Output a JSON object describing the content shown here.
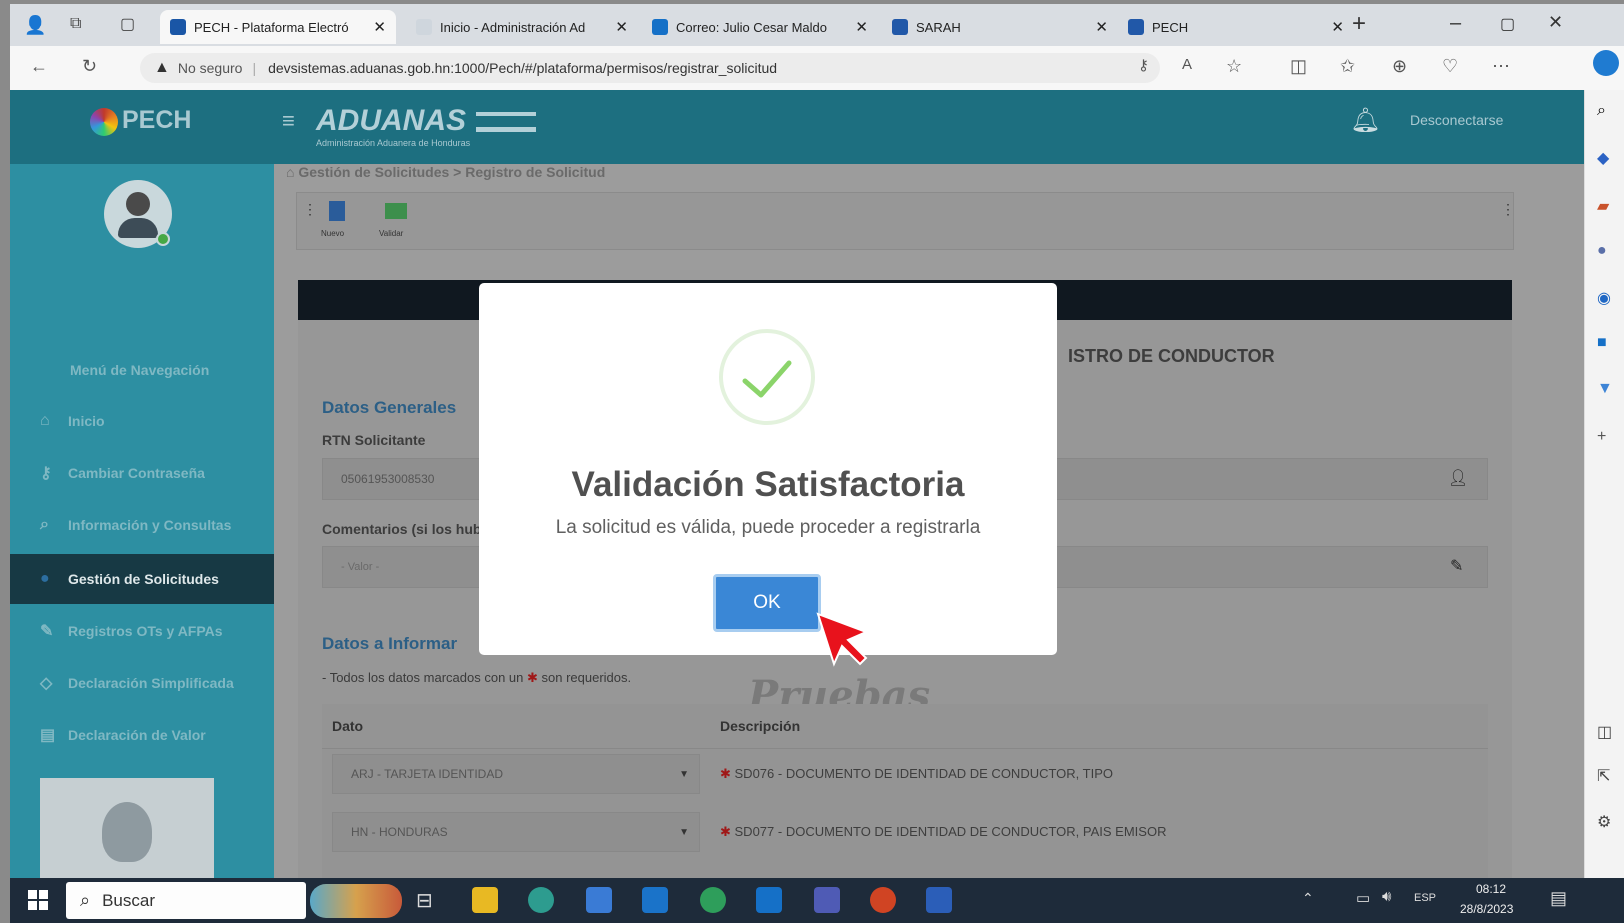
{
  "browser": {
    "tabs": [
      {
        "title": "PECH - Plataforma Electró",
        "active": true,
        "favicon_color": "#1a56a6"
      },
      {
        "title": "Inicio - Administración Ad",
        "active": false,
        "favicon_color": "#cfd6dd"
      },
      {
        "title": "Correo: Julio Cesar Maldo",
        "active": false,
        "favicon_color": "#1570c7"
      },
      {
        "title": "SARAH",
        "active": false,
        "favicon_color": "#2158a8"
      },
      {
        "title": "PECH",
        "active": false,
        "favicon_color": "#2158a8"
      }
    ],
    "new_tab": "+",
    "security_label": "No seguro",
    "url": "devsistemas.aduanas.gob.hn:1000/Pech/#/plataforma/permisos/registrar_solicitud"
  },
  "app": {
    "brand": "PECH",
    "logo_text": "ADUANAS",
    "logo_subtext": "Administración Aduanera de Honduras",
    "logout": "Desconectarse",
    "breadcrumb": "Gestión de Solicitudes > Registro de Solicitud",
    "sidebar": {
      "nav_title": "Menú de Navegación",
      "items": [
        {
          "label": "Inicio",
          "icon": "home-icon",
          "active": false
        },
        {
          "label": "Cambiar Contraseña",
          "icon": "key-icon",
          "active": false
        },
        {
          "label": "Información y Consultas",
          "icon": "search-icon",
          "active": false
        },
        {
          "label": "Gestión de Solicitudes",
          "icon": "circle-icon",
          "active": true
        },
        {
          "label": "Registros OTs y AFPAs",
          "icon": "edit-icon",
          "active": false
        },
        {
          "label": "Declaración Simplificada",
          "icon": "tag-icon",
          "active": false
        },
        {
          "label": "Declaración de Valor",
          "icon": "calendar-icon",
          "active": false
        }
      ]
    },
    "toolbar": {
      "new_label": "Nuevo",
      "validate_label": "Validar"
    },
    "form": {
      "heading": "ISTRO DE CONDUCTOR",
      "general_section": "Datos Generales",
      "rtn_label": "RTN Solicitante",
      "rtn_value": "05061953008530",
      "comments_label": "Comentarios (si los hubi",
      "comments_placeholder": "- Valor -",
      "inform_section": "Datos a Informar",
      "required_note": "- Todos los datos marcados con un",
      "required_note_suffix": "son requeridos.",
      "watermark": "Pruebas",
      "table_headers": [
        "Dato",
        "Descripción"
      ],
      "rows": [
        {
          "dato": "ARJ - TARJETA IDENTIDAD",
          "descripcion": "SD076 - DOCUMENTO DE IDENTIDAD DE CONDUCTOR, TIPO"
        },
        {
          "dato": "HN - HONDURAS",
          "descripcion": "SD077 - DOCUMENTO DE IDENTIDAD DE CONDUCTOR, PAIS EMISOR"
        }
      ]
    }
  },
  "modal": {
    "title": "Validación Satisfactoria",
    "message": "La solicitud es válida, puede proceder a registrarla",
    "ok_label": "OK",
    "check_color": "#8bd46a"
  },
  "taskbar": {
    "search_label": "Buscar",
    "lang": "ESP",
    "time": "08:12",
    "date": "28/8/2023"
  }
}
